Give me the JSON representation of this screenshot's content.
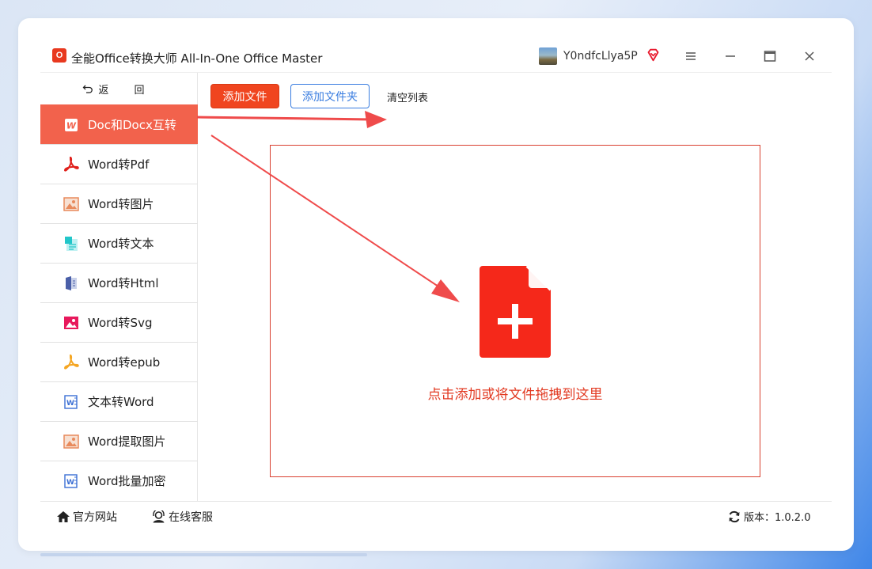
{
  "app": {
    "logo_text": "O",
    "title": "全能Office转换大师 All-In-One Office Master",
    "username": "Y0ndfcLlya5P"
  },
  "sidebar": {
    "back_label": "返 回",
    "items": [
      {
        "label": "Doc和Docx互转",
        "icon": "word-doc-icon",
        "active": true
      },
      {
        "label": "Word转Pdf",
        "icon": "pdf-icon"
      },
      {
        "label": "Word转图片",
        "icon": "image-icon"
      },
      {
        "label": "Word转文本",
        "icon": "text-doc-icon"
      },
      {
        "label": "Word转Html",
        "icon": "html-icon"
      },
      {
        "label": "Word转Svg",
        "icon": "svg-image-icon"
      },
      {
        "label": "Word转epub",
        "icon": "epub-icon"
      },
      {
        "label": "文本转Word",
        "icon": "word-icon"
      },
      {
        "label": "Word提取图片",
        "icon": "image-extract-icon"
      },
      {
        "label": "Word批量加密",
        "icon": "word-lock-icon"
      }
    ]
  },
  "toolbar": {
    "add_file": "添加文件",
    "add_folder": "添加文件夹",
    "clear_list": "清空列表"
  },
  "dropzone": {
    "text": "点击添加或将文件拖拽到这里"
  },
  "footer": {
    "site": "官方网站",
    "service": "在线客服",
    "version": "版本：1.0.2.0"
  },
  "colors": {
    "accent": "#f0451f",
    "active_nav": "#f2624c",
    "link_blue": "#3a7de0"
  }
}
